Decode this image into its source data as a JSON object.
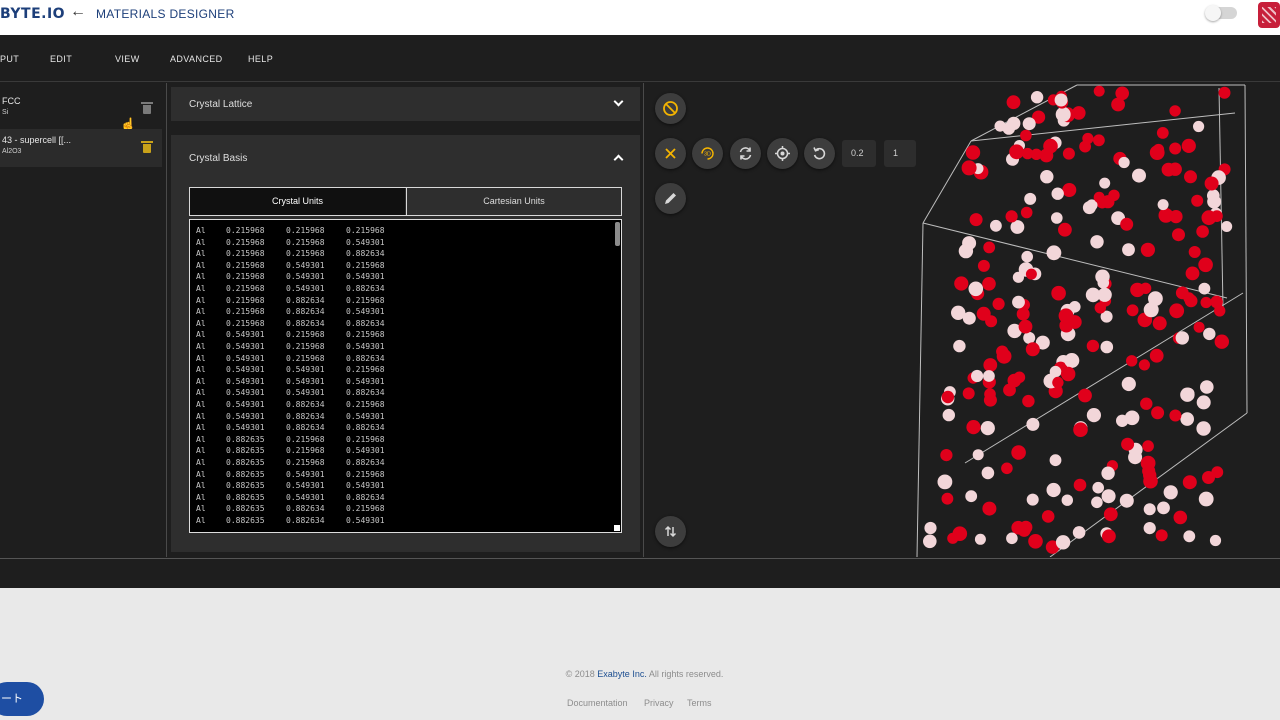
{
  "header": {
    "logo_text": "BYTE.IO",
    "back_icon": "arrow-left-icon",
    "app_title": "MATERIALS DESIGNER"
  },
  "menu": [
    "PUT",
    "EDIT",
    "VIEW",
    "ADVANCED",
    "HELP"
  ],
  "materials": [
    {
      "name": "FCC",
      "formula": "Si",
      "selected": false
    },
    {
      "name": "43 - supercell [[...",
      "formula": "Al2O3",
      "selected": true
    }
  ],
  "accordion": {
    "lattice_title": "Crystal Lattice",
    "basis_title": "Crystal Basis"
  },
  "tabs": {
    "crystal": "Crystal Units",
    "cartesian": "Cartesian Units",
    "active": "crystal"
  },
  "basis_rows": [
    [
      "Al",
      "0.215968",
      "0.215968",
      "0.215968"
    ],
    [
      "Al",
      "0.215968",
      "0.215968",
      "0.549301"
    ],
    [
      "Al",
      "0.215968",
      "0.215968",
      "0.882634"
    ],
    [
      "Al",
      "0.215968",
      "0.549301",
      "0.215968"
    ],
    [
      "Al",
      "0.215968",
      "0.549301",
      "0.549301"
    ],
    [
      "Al",
      "0.215968",
      "0.549301",
      "0.882634"
    ],
    [
      "Al",
      "0.215968",
      "0.882634",
      "0.215968"
    ],
    [
      "Al",
      "0.215968",
      "0.882634",
      "0.549301"
    ],
    [
      "Al",
      "0.215968",
      "0.882634",
      "0.882634"
    ],
    [
      "Al",
      "0.549301",
      "0.215968",
      "0.215968"
    ],
    [
      "Al",
      "0.549301",
      "0.215968",
      "0.549301"
    ],
    [
      "Al",
      "0.549301",
      "0.215968",
      "0.882634"
    ],
    [
      "Al",
      "0.549301",
      "0.549301",
      "0.215968"
    ],
    [
      "Al",
      "0.549301",
      "0.549301",
      "0.549301"
    ],
    [
      "Al",
      "0.549301",
      "0.549301",
      "0.882634"
    ],
    [
      "Al",
      "0.549301",
      "0.882634",
      "0.215968"
    ],
    [
      "Al",
      "0.549301",
      "0.882634",
      "0.549301"
    ],
    [
      "Al",
      "0.549301",
      "0.882634",
      "0.882634"
    ],
    [
      "Al",
      "0.882635",
      "0.215968",
      "0.215968"
    ],
    [
      "Al",
      "0.882635",
      "0.215968",
      "0.549301"
    ],
    [
      "Al",
      "0.882635",
      "0.215968",
      "0.882634"
    ],
    [
      "Al",
      "0.882635",
      "0.549301",
      "0.215968"
    ],
    [
      "Al",
      "0.882635",
      "0.549301",
      "0.549301"
    ],
    [
      "Al",
      "0.882635",
      "0.549301",
      "0.882634"
    ],
    [
      "Al",
      "0.882635",
      "0.882634",
      "0.215968"
    ],
    [
      "Al",
      "0.882635",
      "0.882634",
      "0.549301"
    ]
  ],
  "viewer": {
    "sphere_radius": "0.2",
    "repetitions": "1",
    "icons": [
      "disable-icon",
      "close-icon",
      "rotate-3d-icon",
      "refresh-icon",
      "center-icon",
      "reset-icon",
      "edit-icon",
      "swap-vertical-icon"
    ],
    "colors": {
      "oxygen": "#e0001b",
      "aluminum": "#f2d6d9",
      "accent": "#f5b400"
    }
  },
  "footer": {
    "copyright_prefix": "© 2018",
    "company": "Exabyte Inc.",
    "rights": "All rights reserved.",
    "links": [
      "Documentation",
      "Privacy",
      "Terms"
    ]
  },
  "chat_button": "ート"
}
